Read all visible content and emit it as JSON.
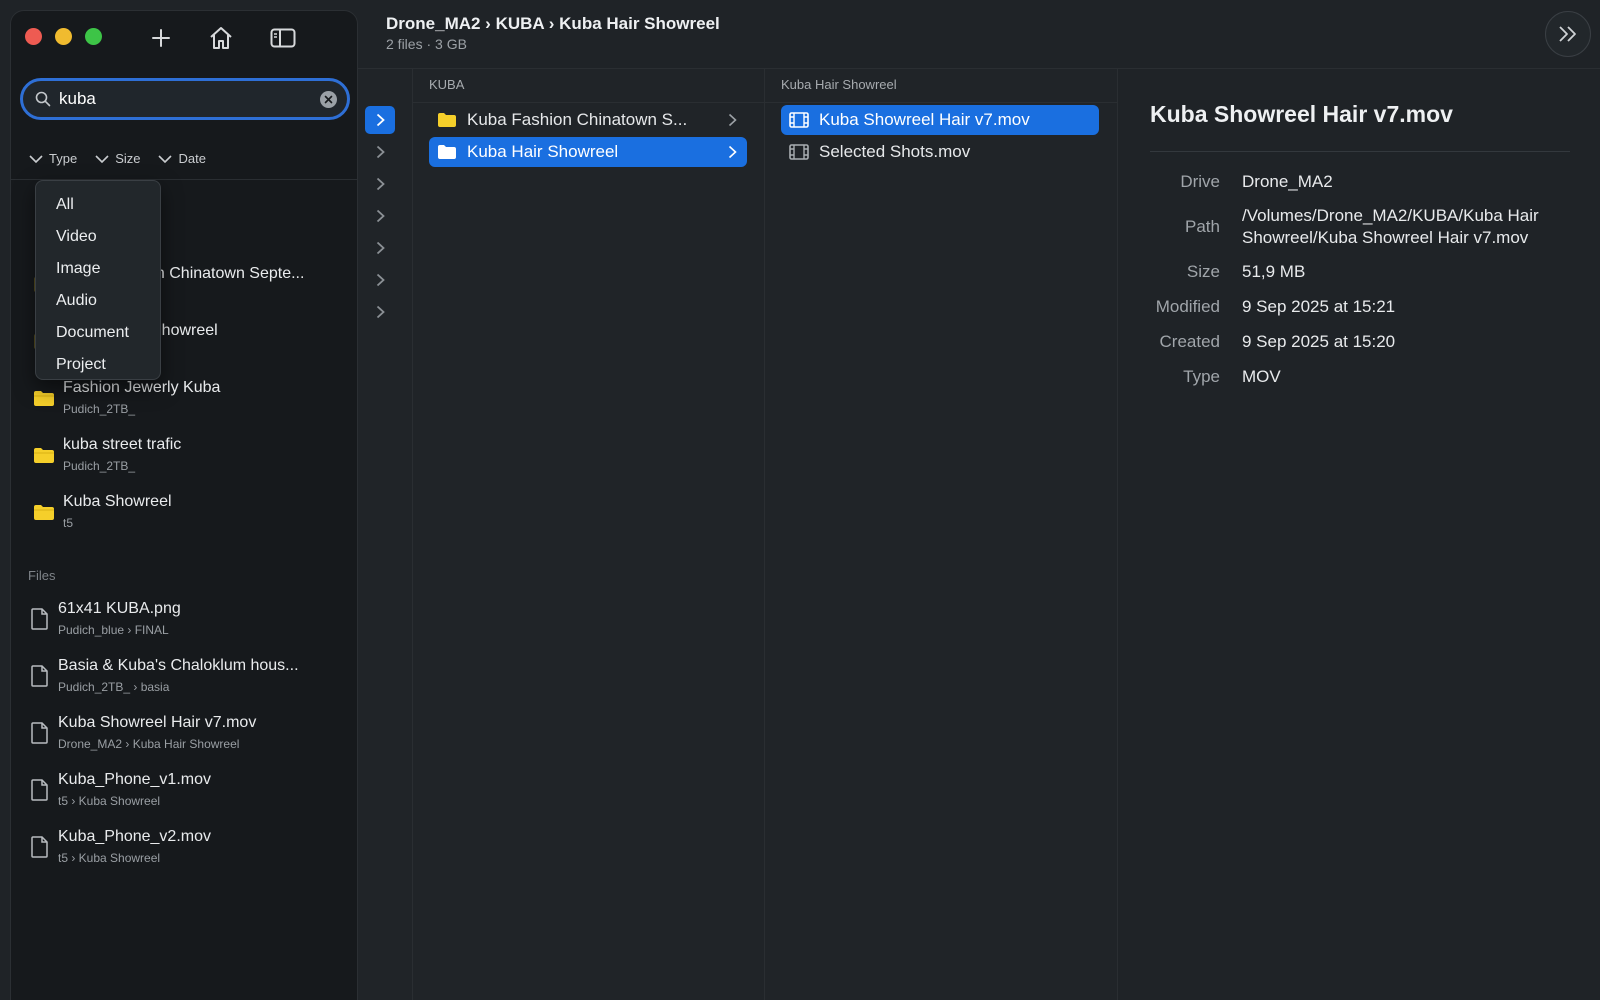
{
  "header": {
    "breadcrumb": "Drone_MA2 › KUBA › Kuba Hair Showreel",
    "summary": "2 files · 3 GB"
  },
  "search": {
    "value": "kuba"
  },
  "filters": [
    {
      "label": "Type"
    },
    {
      "label": "Size"
    },
    {
      "label": "Date"
    }
  ],
  "type_menu": {
    "options": [
      "All",
      "Video",
      "Image",
      "Audio",
      "Document",
      "Project"
    ]
  },
  "sidebar": {
    "partial_folders": [
      {
        "title": "on Chinatown Septe..."
      },
      {
        "title": "Showreel"
      }
    ],
    "folders": [
      {
        "title": "Fashion Jewerly Kuba",
        "sub": "Pudich_2TB_"
      },
      {
        "title": "kuba street trafic",
        "sub": "Pudich_2TB_"
      },
      {
        "title": "Kuba Showreel",
        "sub": "t5"
      }
    ],
    "files_label": "Files",
    "files": [
      {
        "title": "61x41 KUBA.png",
        "sub": "Pudich_blue › FINAL"
      },
      {
        "title": "Basia & Kuba's Chaloklum hous...",
        "sub": "Pudich_2TB_ › basia"
      },
      {
        "title": "Kuba Showreel Hair  v7.mov",
        "sub": "Drone_MA2 › Kuba Hair Showreel"
      },
      {
        "title": "Kuba_Phone_v1.mov",
        "sub": "t5 › Kuba Showreel"
      },
      {
        "title": "Kuba_Phone_v2.mov",
        "sub": "t5 › Kuba Showreel"
      }
    ]
  },
  "columns": {
    "kuba": {
      "header": "KUBA",
      "items": [
        {
          "label": "Kuba Fashion Chinatown S...",
          "selected": false
        },
        {
          "label": "Kuba Hair Showreel",
          "selected": true
        }
      ]
    },
    "showreel": {
      "header": "Kuba Hair Showreel",
      "items": [
        {
          "label": "Kuba Showreel Hair  v7.mov",
          "selected": true
        },
        {
          "label": "Selected Shots.mov",
          "selected": false
        }
      ]
    }
  },
  "detail": {
    "title": "Kuba Showreel Hair  v7.mov",
    "props": [
      {
        "key": "Drive",
        "value": "Drone_MA2"
      },
      {
        "key": "Path",
        "value": "/Volumes/Drone_MA2/KUBA/Kuba Hair Showreel/Kuba Showreel Hair  v7.mov"
      },
      {
        "key": "Size",
        "value": "51,9 MB"
      },
      {
        "key": "Modified",
        "value": "9 Sep 2025 at 15:21"
      },
      {
        "key": "Created",
        "value": "9 Sep 2025 at 15:20"
      },
      {
        "key": "Type",
        "value": "MOV"
      }
    ]
  },
  "colors": {
    "accent": "#1a6fe0",
    "folder": "#f5cf2a",
    "search_ring": "#2e6fd6"
  }
}
